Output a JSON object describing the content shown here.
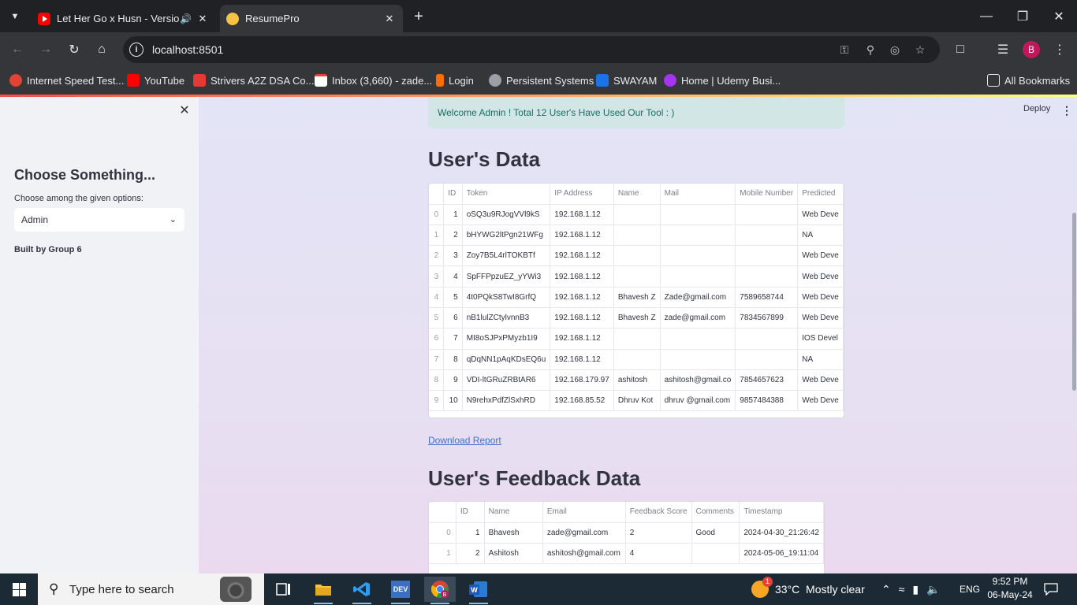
{
  "browser": {
    "tabs": [
      {
        "title": "Let Her Go x Husn - Version",
        "icon": "youtube-icon",
        "audio": true
      },
      {
        "title": "ResumePro",
        "icon": "streamlit-icon",
        "active": true
      }
    ],
    "url": "localhost:8501",
    "profile_initial": "B",
    "bookmarks": [
      {
        "label": "Internet Speed Test...",
        "color": "#e34234"
      },
      {
        "label": "YouTube",
        "color": "#ff0000"
      },
      {
        "label": "Strivers A2Z DSA Co...",
        "color": "#e53935"
      },
      {
        "label": "Inbox (3,660) - zade...",
        "color": "#ea4335"
      },
      {
        "label": "Login",
        "color": "#ff6d00"
      },
      {
        "label": "Persistent Systems",
        "color": "#9aa0a6"
      },
      {
        "label": "SWAYAM",
        "color": "#1a73e8"
      },
      {
        "label": "Home | Udemy Busi...",
        "color": "#a435f0"
      }
    ],
    "all_bookmarks": "All Bookmarks"
  },
  "sidebar": {
    "title": "Choose Something...",
    "select_label": "Choose among the given options:",
    "select_value": "Admin",
    "credit": "Built by Group 6"
  },
  "header": {
    "deploy": "Deploy"
  },
  "main": {
    "welcome": "Welcome Admin ! Total 12 User's Have Used Our Tool : )",
    "users_title": "User's Data",
    "download": "Download Report",
    "feedback_title": "User's Feedback Data"
  },
  "users_table": {
    "columns": [
      "",
      "ID",
      "Token",
      "IP Address",
      "Name",
      "Mail",
      "Mobile Number",
      "Predicted"
    ],
    "rows": [
      [
        "0",
        "1",
        "oSQ3u9RJogVVl9kS",
        "192.168.1.12",
        "",
        "",
        "",
        "Web Deve"
      ],
      [
        "1",
        "2",
        "bHYWG2ltPgn21WFg",
        "192.168.1.12",
        "",
        "",
        "",
        "NA"
      ],
      [
        "2",
        "3",
        "Zoy7B5L4rlTOKBTf",
        "192.168.1.12",
        "",
        "",
        "",
        "Web Deve"
      ],
      [
        "3",
        "4",
        "SpFFPpzuEZ_yYWi3",
        "192.168.1.12",
        "",
        "",
        "",
        "Web Deve"
      ],
      [
        "4",
        "5",
        "4t0PQkS8TwI8GrfQ",
        "192.168.1.12",
        "Bhavesh Z",
        "Zade@gmail.com",
        "7589658744",
        "Web Deve"
      ],
      [
        "5",
        "6",
        "nB1lulZCtylvnnB3",
        "192.168.1.12",
        "Bhavesh Z",
        "zade@gmail.com",
        "7834567899",
        "Web Deve"
      ],
      [
        "6",
        "7",
        "MI8oSJPxPMyzb1I9",
        "192.168.1.12",
        "",
        "",
        "",
        "IOS Devel"
      ],
      [
        "7",
        "8",
        "qDqNN1pAqKDsEQ6u",
        "192.168.1.12",
        "",
        "",
        "",
        "NA"
      ],
      [
        "8",
        "9",
        "VDI-ltGRuZRBtAR6",
        "192.168.179.97",
        "ashitosh",
        "ashitosh@gmail.co",
        "7854657623",
        "Web Deve"
      ],
      [
        "9",
        "10",
        "N9rehxPdfZlSxhRD",
        "192.168.85.52",
        "Dhruv Kot",
        "dhruv @gmail.com",
        "9857484388",
        "Web Deve"
      ]
    ]
  },
  "feedback_table": {
    "columns": [
      "",
      "ID",
      "Name",
      "Email",
      "Feedback Score",
      "Comments",
      "Timestamp"
    ],
    "rows": [
      [
        "0",
        "1",
        "Bhavesh",
        "zade@gmail.com",
        "2",
        "Good",
        "2024-04-30_21:26:42"
      ],
      [
        "1",
        "2",
        "Ashitosh",
        "ashitosh@gmail.com",
        "4",
        "",
        "2024-05-06_19:11:04"
      ]
    ]
  },
  "taskbar": {
    "search_placeholder": "Type here to search",
    "weather": "33°C  Mostly clear",
    "weather_badge": "1",
    "language": "ENG",
    "time": "9:52 PM",
    "date": "06-May-24"
  }
}
